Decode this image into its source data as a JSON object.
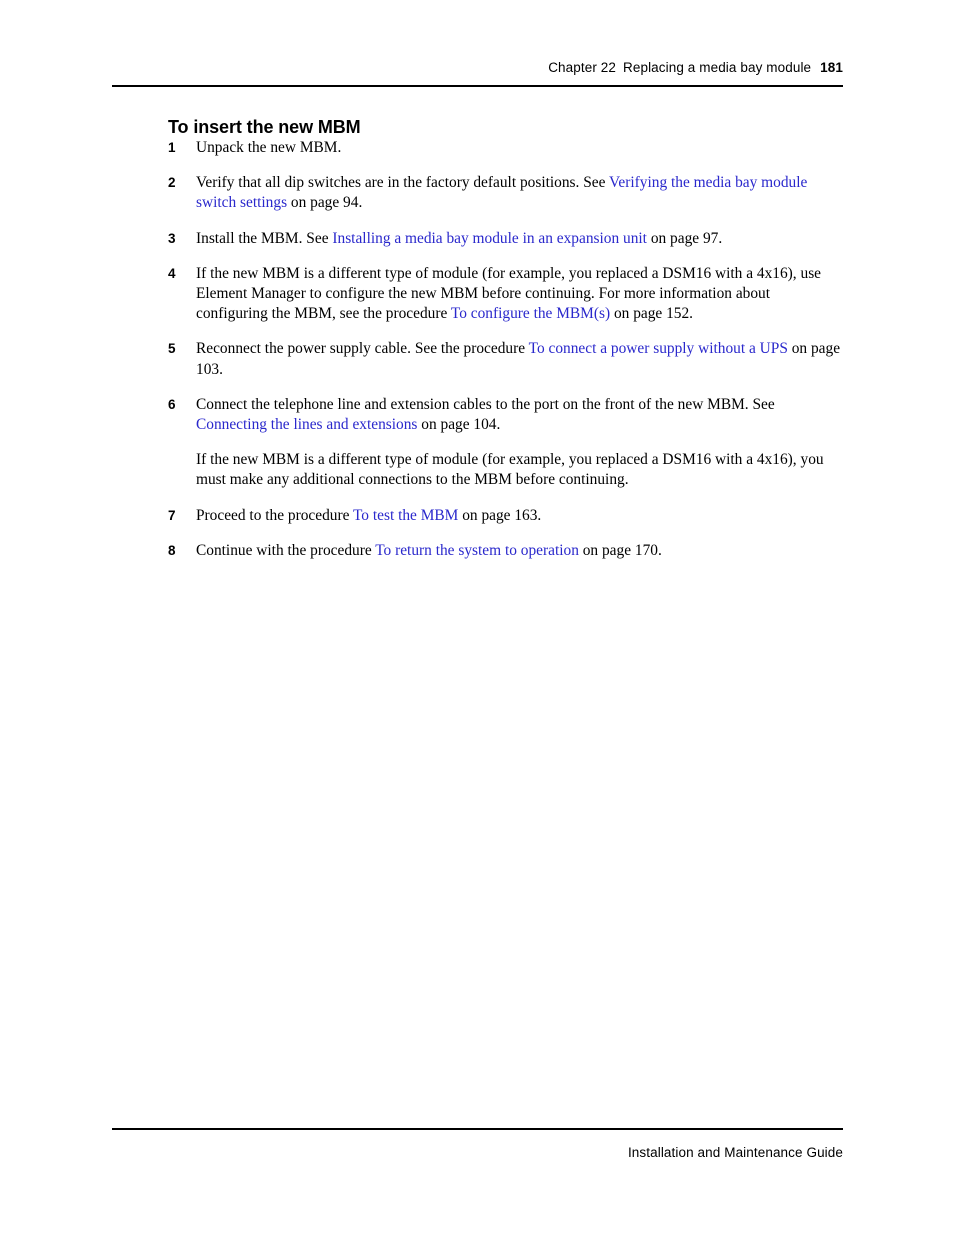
{
  "header": {
    "chapter": "Chapter 22",
    "chapter_title": "Replacing a media bay module",
    "page_number": "181"
  },
  "footer": {
    "guide_title": "Installation and Maintenance Guide"
  },
  "colors": {
    "link": "#2a28cc",
    "text": "#000000",
    "background": "#ffffff"
  },
  "section": {
    "title": "To insert the new MBM",
    "steps": [
      {
        "number": "1",
        "parts": [
          {
            "type": "text",
            "value": "Unpack the new MBM."
          }
        ]
      },
      {
        "number": "2",
        "parts": [
          {
            "type": "text",
            "value": "Verify that all dip switches are in the factory default positions. See "
          },
          {
            "type": "link",
            "value": "Verifying the media bay module switch settings"
          },
          {
            "type": "text",
            "value": " on page 94."
          }
        ]
      },
      {
        "number": "3",
        "parts": [
          {
            "type": "text",
            "value": "Install the MBM. See "
          },
          {
            "type": "link",
            "value": "Installing a media bay module in an expansion unit"
          },
          {
            "type": "text",
            "value": " on page 97."
          }
        ]
      },
      {
        "number": "4",
        "parts": [
          {
            "type": "text",
            "value": "If the new MBM is a different type of module (for example, you replaced a DSM16 with a 4x16), use Element Manager to configure the new MBM before continuing. For more information about configuring the MBM, see the procedure "
          },
          {
            "type": "link",
            "value": "To configure the MBM(s)"
          },
          {
            "type": "text",
            "value": " on page 152."
          }
        ]
      },
      {
        "number": "5",
        "parts": [
          {
            "type": "text",
            "value": "Reconnect the power supply cable. See the procedure "
          },
          {
            "type": "link",
            "value": "To connect a power supply without a UPS"
          },
          {
            "type": "text",
            "value": " on page 103."
          }
        ]
      },
      {
        "number": "6",
        "parts": [
          {
            "type": "text",
            "value": "Connect the telephone line and extension cables to the port on the front of the new MBM. See "
          },
          {
            "type": "link",
            "value": "Connecting the lines and extensions"
          },
          {
            "type": "text",
            "value": " on page 104."
          }
        ],
        "continuation": [
          {
            "parts": [
              {
                "type": "text",
                "value": "If the new MBM is a different type of module (for example, you replaced a DSM16 with a 4x16), you must make any additional connections to the MBM before continuing."
              }
            ]
          }
        ]
      },
      {
        "number": "7",
        "parts": [
          {
            "type": "text",
            "value": "Proceed to the procedure "
          },
          {
            "type": "link",
            "value": "To test the MBM"
          },
          {
            "type": "text",
            "value": " on page 163."
          }
        ]
      },
      {
        "number": "8",
        "parts": [
          {
            "type": "text",
            "value": "Continue with the procedure "
          },
          {
            "type": "link",
            "value": "To return the system to operation"
          },
          {
            "type": "text",
            "value": " on page 170."
          }
        ]
      }
    ]
  }
}
